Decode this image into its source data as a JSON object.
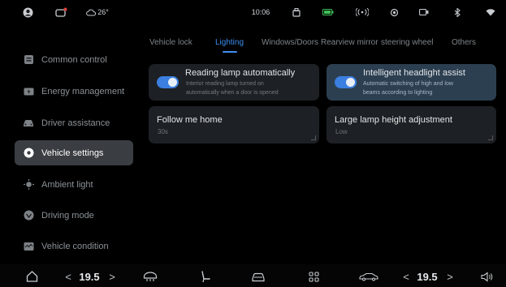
{
  "status_bar": {
    "weather": "26°",
    "time": "10:06"
  },
  "sidebar": {
    "items": [
      {
        "label": "Common control",
        "icon": "common-control-icon"
      },
      {
        "label": "Energy management",
        "icon": "energy-management-icon"
      },
      {
        "label": "Driver assistance",
        "icon": "driver-assistance-icon"
      },
      {
        "label": "Vehicle settings",
        "icon": "vehicle-settings-icon",
        "selected": true
      },
      {
        "label": "Ambient light",
        "icon": "ambient-light-icon"
      },
      {
        "label": "Driving mode",
        "icon": "driving-mode-icon"
      },
      {
        "label": "Vehicle condition",
        "icon": "vehicle-condition-icon"
      }
    ]
  },
  "tabs": [
    {
      "label": "Vehicle lock"
    },
    {
      "label": "Lighting",
      "selected": true
    },
    {
      "label": "Windows/Doors"
    },
    {
      "label": "Rearview mirror"
    },
    {
      "label": "steering wheel"
    },
    {
      "label": "Others"
    }
  ],
  "lighting": {
    "reading_lamp": {
      "title": "Reading lamp automatically",
      "line1": "Interior reading lamp turned on",
      "line2": "automatically when a door is opened",
      "enabled": true
    },
    "headlight_assist": {
      "title": "Intelligent headlight assist",
      "line1": "Automatic switching of high and low",
      "line2": "beams according to lighting",
      "enabled": true
    },
    "follow_me_home": {
      "title": "Follow me home",
      "value": "30s"
    },
    "lamp_height": {
      "title": "Large lamp height adjustment",
      "value": "Low"
    }
  },
  "bottom_bar": {
    "left_temp": "19.5",
    "right_temp": "19.5",
    "left_arrow_prev": "<",
    "left_arrow_next": ">",
    "right_arrow_prev": "<",
    "right_arrow_next": ">"
  },
  "colors": {
    "accent": "#3d8ef0",
    "active_card": "#2c3f50",
    "card": "#1d2024",
    "sidebar_active": "#3a3d42"
  }
}
